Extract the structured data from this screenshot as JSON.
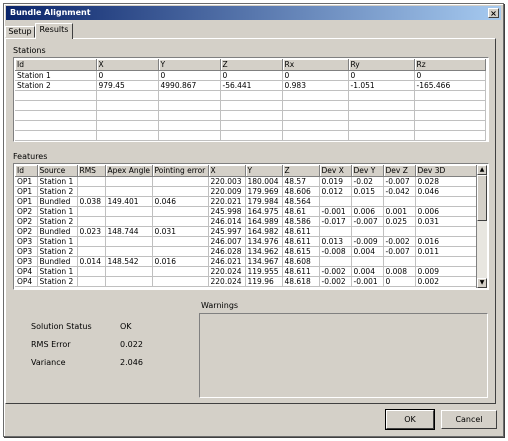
{
  "window": {
    "title": "Bundle Alignment",
    "close_symbol": "×"
  },
  "tabs": [
    {
      "label": "Setup"
    },
    {
      "label": "Results"
    }
  ],
  "stations": {
    "section_label": "Stations",
    "columns": [
      "Id",
      "X",
      "Y",
      "Z",
      "Rx",
      "Ry",
      "Rz"
    ],
    "rows": [
      [
        "Station 1",
        "0",
        "0",
        "0",
        "0",
        "0",
        "0"
      ],
      [
        "Station 2",
        "979.45",
        "4990.867",
        "-56.441",
        "0.983",
        "-1.051",
        "-165.466"
      ]
    ]
  },
  "features": {
    "section_label": "Features",
    "columns": [
      "Id",
      "Source",
      "RMS",
      "Apex Angle",
      "Pointing error",
      "X",
      "Y",
      "Z",
      "Dev X",
      "Dev Y",
      "Dev Z",
      "Dev 3D"
    ],
    "rows": [
      [
        "OP1",
        "Station 1",
        "",
        "",
        "",
        "220.003",
        "180.004",
        "48.57",
        "0.019",
        "-0.02",
        "-0.007",
        "0.028"
      ],
      [
        "OP1",
        "Station 2",
        "",
        "",
        "",
        "220.009",
        "179.969",
        "48.606",
        "0.012",
        "0.015",
        "-0.042",
        "0.046"
      ],
      [
        "OP1",
        "Bundled",
        "0.038",
        "149.401",
        "0.046",
        "220.021",
        "179.984",
        "48.564",
        "",
        "",
        "",
        ""
      ],
      [
        "OP2",
        "Station 1",
        "",
        "",
        "",
        "245.998",
        "164.975",
        "48.61",
        "-0.001",
        "0.006",
        "0.001",
        "0.006"
      ],
      [
        "OP2",
        "Station 2",
        "",
        "",
        "",
        "246.014",
        "164.989",
        "48.586",
        "-0.017",
        "-0.007",
        "0.025",
        "0.031"
      ],
      [
        "OP2",
        "Bundled",
        "0.023",
        "148.744",
        "0.031",
        "245.997",
        "164.982",
        "48.611",
        "",
        "",
        "",
        ""
      ],
      [
        "OP3",
        "Station 1",
        "",
        "",
        "",
        "246.007",
        "134.976",
        "48.611",
        "0.013",
        "-0.009",
        "-0.002",
        "0.016"
      ],
      [
        "OP3",
        "Station 2",
        "",
        "",
        "",
        "246.028",
        "134.962",
        "48.615",
        "-0.008",
        "0.004",
        "-0.007",
        "0.011"
      ],
      [
        "OP3",
        "Bundled",
        "0.014",
        "148.542",
        "0.016",
        "246.021",
        "134.967",
        "48.608",
        "",
        "",
        "",
        ""
      ],
      [
        "OP4",
        "Station 1",
        "",
        "",
        "",
        "220.024",
        "119.955",
        "48.611",
        "-0.002",
        "0.004",
        "0.008",
        "0.009"
      ],
      [
        "OP4",
        "Station 2",
        "",
        "",
        "",
        "220.024",
        "119.96",
        "48.618",
        "-0.002",
        "-0.001",
        "0",
        "0.002"
      ]
    ]
  },
  "summary": {
    "solution_status_label": "Solution Status",
    "solution_status_value": "OK",
    "rms_error_label": "RMS Error",
    "rms_error_value": "0.022",
    "variance_label": "Variance",
    "variance_value": "2.046"
  },
  "warnings": {
    "label": "Warnings"
  },
  "buttons": {
    "ok": "OK",
    "cancel": "Cancel"
  },
  "scroll_arrows": {
    "up": "▲",
    "down": "▼"
  }
}
